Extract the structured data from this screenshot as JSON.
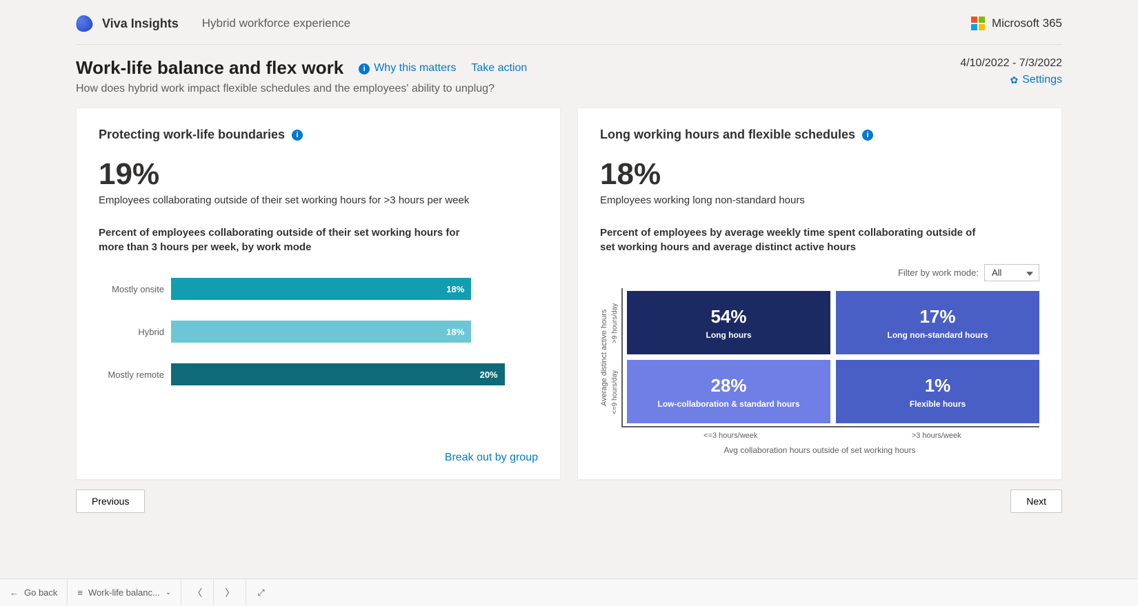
{
  "header": {
    "brand": "Viva Insights",
    "subtitle": "Hybrid workforce experience",
    "ms365": "Microsoft 365"
  },
  "page": {
    "title": "Work-life balance and flex work",
    "why_link": "Why this matters",
    "action_link": "Take action",
    "subtitle": "How does hybrid work impact flexible schedules and the employees' ability to unplug?",
    "date_range": "4/10/2022 - 7/3/2022",
    "settings": "Settings"
  },
  "card_left": {
    "title": "Protecting work-life boundaries",
    "big_pct": "19%",
    "desc": "Employees collaborating outside of their set working hours for >3 hours per week",
    "section": "Percent of employees collaborating outside of their set working hours for more than 3 hours per week, by work mode",
    "break_link": "Break out by group"
  },
  "card_right": {
    "title": "Long working hours and flexible schedules",
    "big_pct": "18%",
    "desc": "Employees working long non-standard hours",
    "section": "Percent of employees by average weekly time spent collaborating outside of set working hours and average distinct active hours",
    "filter_label": "Filter by work mode:",
    "filter_value": "All",
    "y_axis": "Average distinct active hours",
    "y_tick_high": ">9 hours/day",
    "y_tick_low": "<=9 hours/day",
    "x_tick_left": "<=3 hours/week",
    "x_tick_right": ">3 hours/week",
    "x_axis": "Avg collaboration hours outside of set working hours"
  },
  "pagination": {
    "prev": "Previous",
    "next": "Next"
  },
  "bottom": {
    "go_back": "Go back",
    "crumb": "Work-life balanc..."
  },
  "chart_data": [
    {
      "type": "bar",
      "title": "Percent of employees collaborating outside of their set working hours for more than 3 hours per week, by work mode",
      "categories": [
        "Mostly onsite",
        "Hybrid",
        "Mostly remote"
      ],
      "values": [
        18,
        18,
        20
      ],
      "colors": [
        "#139db0",
        "#6bc7d6",
        "#0e6a78"
      ],
      "xlim": [
        0,
        22
      ],
      "xlabel": "",
      "ylabel": ""
    },
    {
      "type": "heatmap",
      "title": "Percent of employees by avg collaboration hours outside set working hours vs avg distinct active hours",
      "x_categories": [
        "<=3 hours/week",
        ">3 hours/week"
      ],
      "y_categories": [
        ">9 hours/day",
        "<=9 hours/day"
      ],
      "xlabel": "Avg collaboration hours outside of set working hours",
      "ylabel": "Average distinct active hours",
      "cells": [
        {
          "x": "<=3 hours/week",
          "y": ">9 hours/day",
          "value": 54,
          "label": "Long hours",
          "color": "#1b2a63"
        },
        {
          "x": ">3 hours/week",
          "y": ">9 hours/day",
          "value": 17,
          "label": "Long non-standard hours",
          "color": "#4a5fc6"
        },
        {
          "x": "<=3 hours/week",
          "y": "<=9 hours/day",
          "value": 28,
          "label": "Low-collaboration & standard hours",
          "color": "#6f7fe6"
        },
        {
          "x": ">3 hours/week",
          "y": "<=9 hours/day",
          "value": 1,
          "label": "Flexible hours",
          "color": "#4a5fc6"
        }
      ]
    }
  ]
}
